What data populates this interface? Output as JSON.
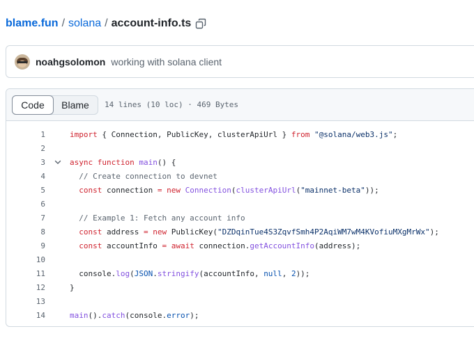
{
  "breadcrumb": {
    "owner": "blame.fun",
    "sep1": "/",
    "repo": "solana",
    "sep2": "/",
    "file": "account-info.ts"
  },
  "commit": {
    "author": "noahgsolomon",
    "message": "working with solana client"
  },
  "file_header": {
    "tabs": [
      "Code",
      "Blame"
    ],
    "active_tab": "Code",
    "meta": "14 lines (10 loc) · 469 Bytes"
  },
  "code": {
    "lines": [
      {
        "n": "1",
        "tokens": [
          {
            "t": "import",
            "c": "k"
          },
          {
            "t": " { Connection, PublicKey, clusterApiUrl } ",
            "c": ""
          },
          {
            "t": "from",
            "c": "k"
          },
          {
            "t": " ",
            "c": ""
          },
          {
            "t": "\"@solana/web3.js\"",
            "c": "s"
          },
          {
            "t": ";",
            "c": ""
          }
        ]
      },
      {
        "n": "2",
        "tokens": []
      },
      {
        "n": "3",
        "tokens": [
          {
            "t": "async",
            "c": "k"
          },
          {
            "t": " ",
            "c": ""
          },
          {
            "t": "function",
            "c": "k"
          },
          {
            "t": " ",
            "c": ""
          },
          {
            "t": "main",
            "c": "f"
          },
          {
            "t": "() {",
            "c": ""
          }
        ]
      },
      {
        "n": "4",
        "tokens": [
          {
            "t": "  // Create connection to devnet",
            "c": "c"
          }
        ]
      },
      {
        "n": "5",
        "tokens": [
          {
            "t": "  ",
            "c": ""
          },
          {
            "t": "const",
            "c": "k"
          },
          {
            "t": " connection ",
            "c": ""
          },
          {
            "t": "=",
            "c": "k"
          },
          {
            "t": " ",
            "c": ""
          },
          {
            "t": "new",
            "c": "k"
          },
          {
            "t": " ",
            "c": ""
          },
          {
            "t": "Connection",
            "c": "f"
          },
          {
            "t": "(",
            "c": ""
          },
          {
            "t": "clusterApiUrl",
            "c": "f"
          },
          {
            "t": "(",
            "c": ""
          },
          {
            "t": "\"mainnet-beta\"",
            "c": "s"
          },
          {
            "t": "));",
            "c": ""
          }
        ]
      },
      {
        "n": "6",
        "tokens": []
      },
      {
        "n": "7",
        "tokens": [
          {
            "t": "  // Example 1: Fetch any account info",
            "c": "c"
          }
        ]
      },
      {
        "n": "8",
        "tokens": [
          {
            "t": "  ",
            "c": ""
          },
          {
            "t": "const",
            "c": "k"
          },
          {
            "t": " address ",
            "c": ""
          },
          {
            "t": "=",
            "c": "k"
          },
          {
            "t": " ",
            "c": ""
          },
          {
            "t": "new",
            "c": "k"
          },
          {
            "t": " PublicKey(",
            "c": ""
          },
          {
            "t": "\"DZDqinTue4S3ZqvfSmh4P2AqiWM7wM4KVofiuMXgMrWx\"",
            "c": "s"
          },
          {
            "t": ");",
            "c": ""
          }
        ]
      },
      {
        "n": "9",
        "tokens": [
          {
            "t": "  ",
            "c": ""
          },
          {
            "t": "const",
            "c": "k"
          },
          {
            "t": " accountInfo ",
            "c": ""
          },
          {
            "t": "=",
            "c": "k"
          },
          {
            "t": " ",
            "c": ""
          },
          {
            "t": "await",
            "c": "k"
          },
          {
            "t": " connection.",
            "c": ""
          },
          {
            "t": "getAccountInfo",
            "c": "f"
          },
          {
            "t": "(address);",
            "c": ""
          }
        ]
      },
      {
        "n": "10",
        "tokens": []
      },
      {
        "n": "11",
        "tokens": [
          {
            "t": "  console.",
            "c": ""
          },
          {
            "t": "log",
            "c": "f"
          },
          {
            "t": "(",
            "c": ""
          },
          {
            "t": "JSON",
            "c": "n"
          },
          {
            "t": ".",
            "c": ""
          },
          {
            "t": "stringify",
            "c": "f"
          },
          {
            "t": "(accountInfo, ",
            "c": ""
          },
          {
            "t": "null",
            "c": "n"
          },
          {
            "t": ", ",
            "c": ""
          },
          {
            "t": "2",
            "c": "n"
          },
          {
            "t": "));",
            "c": ""
          }
        ]
      },
      {
        "n": "12",
        "tokens": [
          {
            "t": "}",
            "c": ""
          }
        ]
      },
      {
        "n": "13",
        "tokens": []
      },
      {
        "n": "14",
        "tokens": [
          {
            "t": "main",
            "c": "f"
          },
          {
            "t": "().",
            "c": ""
          },
          {
            "t": "catch",
            "c": "f"
          },
          {
            "t": "(console.",
            "c": ""
          },
          {
            "t": "error",
            "c": "n"
          },
          {
            "t": ");",
            "c": ""
          }
        ]
      }
    ],
    "fold_line": "3"
  },
  "icons": {
    "copy": "copy-icon",
    "fold": "chevron-down-icon"
  },
  "colors": {
    "link": "#0969da",
    "keyword": "#cf222e",
    "function": "#8250df",
    "string": "#0a3069",
    "comment": "#59636e",
    "constant": "#0550ae"
  }
}
